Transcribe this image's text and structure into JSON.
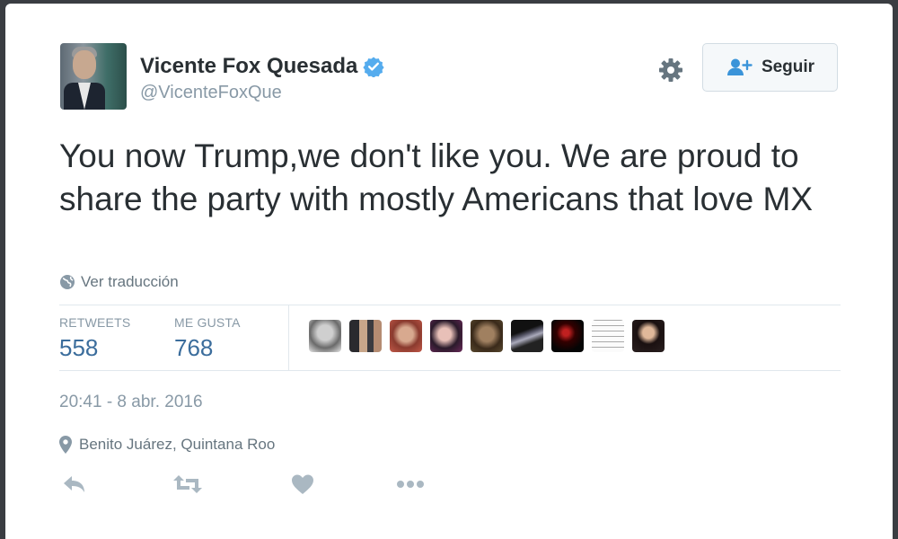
{
  "profile": {
    "name": "Vicente Fox Quesada",
    "handle": "@VicenteFoxQue",
    "verified": true
  },
  "header": {
    "follow_label": "Seguir"
  },
  "tweet": {
    "text": "You now Trump,we don't like you. We are proud to share the party with mostly Americans that love MX",
    "translate_label": "Ver traducción"
  },
  "stats": {
    "retweets_label": "RETWEETS",
    "retweets_value": "558",
    "likes_label": "ME GUSTA",
    "likes_value": "768"
  },
  "meta": {
    "timestamp": "20:41 - 8 abr. 2016",
    "location": "Benito Juárez, Quintana Roo"
  },
  "colors": {
    "text": "#292f33",
    "muted": "#8899a6",
    "stat_value": "#3b6d9c",
    "verified": "#55acee"
  },
  "icons": [
    "verified-badge-icon",
    "gear-icon",
    "follow-person-icon",
    "globe-icon",
    "location-pin-icon",
    "reply-icon",
    "retweet-icon",
    "like-heart-icon",
    "more-dots-icon"
  ]
}
